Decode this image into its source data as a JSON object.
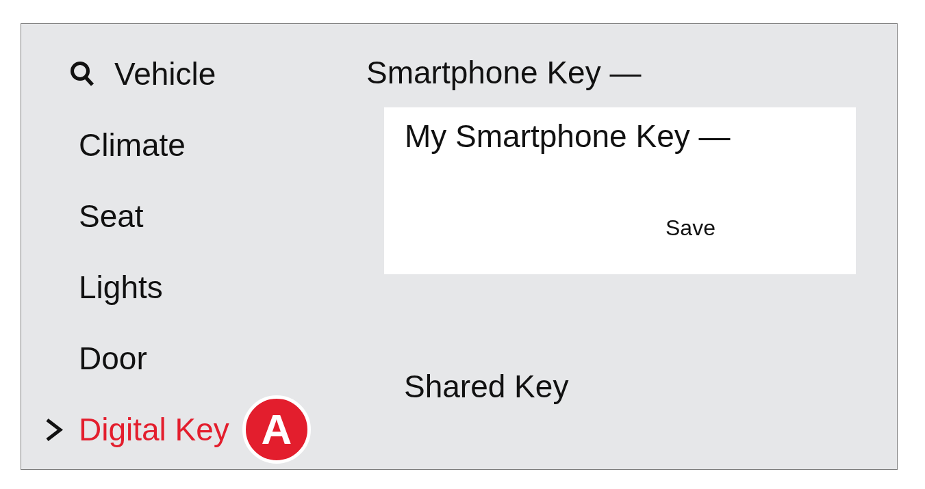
{
  "sidebar": {
    "items": [
      {
        "label": "Vehicle",
        "kind": "search",
        "selected": false
      },
      {
        "label": "Climate",
        "kind": "menu",
        "selected": false
      },
      {
        "label": "Seat",
        "kind": "menu",
        "selected": false
      },
      {
        "label": "Lights",
        "kind": "menu",
        "selected": false
      },
      {
        "label": "Door",
        "kind": "menu",
        "selected": false
      },
      {
        "label": "Digital Key",
        "kind": "menu",
        "selected": true,
        "callout": "A"
      }
    ]
  },
  "main": {
    "heading": "Smartphone Key —",
    "card": {
      "title": "My Smartphone Key —",
      "button": "Save"
    },
    "section": "Shared Key"
  }
}
